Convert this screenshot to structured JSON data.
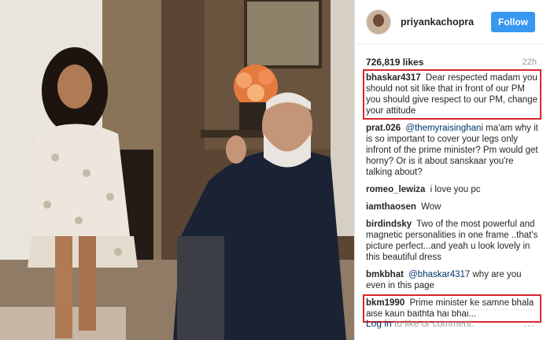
{
  "post": {
    "username": "priyankachopra",
    "follow_label": "Follow",
    "likes": "726,819 likes",
    "time": "22h"
  },
  "comments": [
    {
      "user": "bhaskar4317",
      "mention": "",
      "text": "Dear respected madam you should not sit like that in front of our PM you should give respect to our PM, change your attitude",
      "highlight": true
    },
    {
      "user": "prat.026",
      "mention": "@themyraisinghani",
      "text": " ma'am why it is so important to cover your legs only infront of the prime minister? Pm would get horny? Or is it about sanskaar you're talking about?",
      "highlight": false
    },
    {
      "user": "romeo_lewiza",
      "mention": "",
      "text": "i love you pc",
      "highlight": false
    },
    {
      "user": "iamthaosen",
      "mention": "",
      "text": "Wow",
      "highlight": false
    },
    {
      "user": "birdindsky",
      "mention": "",
      "text": "Two of the most powerful and magnetic personalities in one frame ..that's picture perfect...and yeah u look lovely in this beautiful dress",
      "highlight": false
    },
    {
      "user": "bmkbhat",
      "mention": "@bhaskar4317",
      "text": " why are you even in this page",
      "highlight": false
    },
    {
      "user": "bkm1990",
      "mention": "",
      "text": "Prime minister ke samne bhala aise kaun baithta hai bhai...",
      "highlight": true
    }
  ],
  "footer": {
    "login": "Log in",
    "rest": " to like or comment.",
    "more": "..."
  }
}
